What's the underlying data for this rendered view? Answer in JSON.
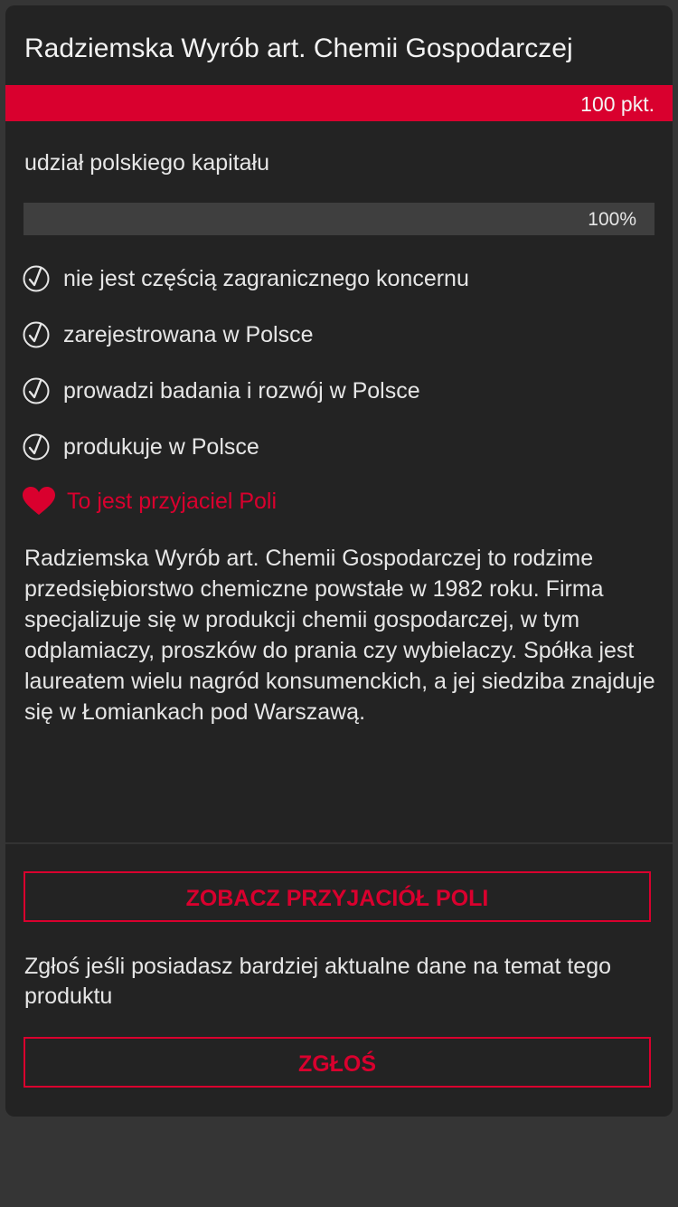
{
  "company": {
    "name": "Radziemska Wyrób art. Chemii Gospodarczej",
    "score_label": "100 pkt.",
    "score": 100
  },
  "capital": {
    "label": "udział polskiego kapitału",
    "value_label": "100%",
    "percent": 100
  },
  "criteria": [
    {
      "label": "nie jest częścią zagranicznego koncernu",
      "icon": "check-circle-icon"
    },
    {
      "label": "zarejestrowana w Polsce",
      "icon": "check-circle-icon"
    },
    {
      "label": "prowadzi badania i rozwój w Polsce",
      "icon": "check-circle-icon"
    },
    {
      "label": "produkuje w Polsce",
      "icon": "check-circle-icon"
    }
  ],
  "friend": {
    "label": "To jest przyjaciel Poli",
    "icon": "heart-icon"
  },
  "description": "Radziemska Wyrób art. Chemii Gospodarczej to rodzime przedsiębiorstwo chemiczne powstałe w 1982 roku. Firma specjalizuje się w produkcji chemii gospodarczej, w tym odplamiaczy, proszków do prania czy wybielaczy. Spółka jest laureatem wielu nagród konsumenckich, a jej siedziba znajduje się w Łomiankach pod Warszawą.",
  "actions": {
    "see_friends_label": "ZOBACZ PRZYJACIÓŁ POLI",
    "report_prompt": "Zgłoś jeśli posiadasz bardziej aktualne dane na temat tego produktu",
    "report_label": "ZGŁOŚ"
  },
  "colors": {
    "accent": "#d9002e",
    "card_background": "#232323",
    "page_background": "#353535",
    "text": "#e6e6e6"
  }
}
